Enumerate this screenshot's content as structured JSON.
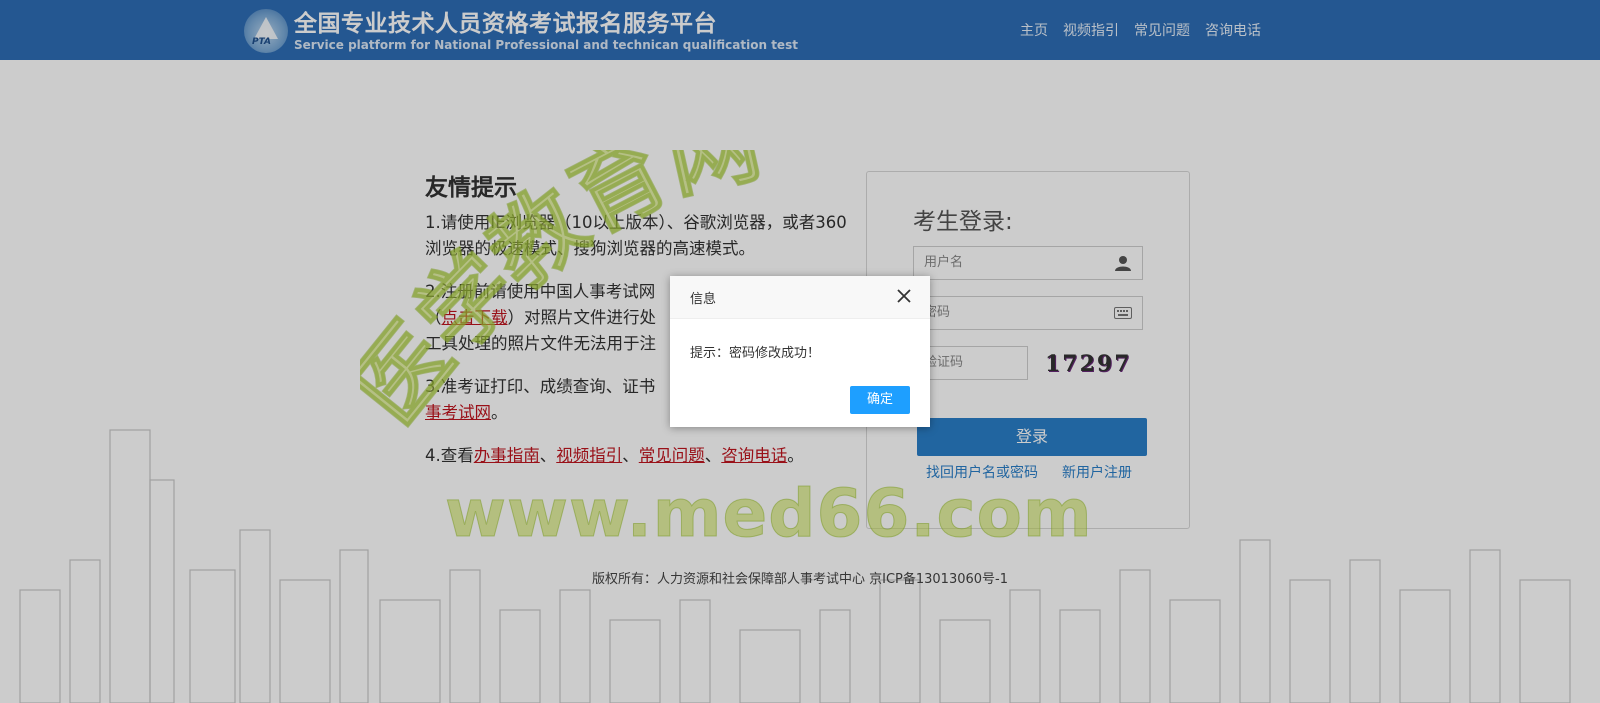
{
  "header": {
    "logo_text": "PTA",
    "title": "全国专业技术人员资格考试报名服务平台",
    "subtitle": "Service platform for National Professional and technican qualification test",
    "nav": [
      "主页",
      "视频指引",
      "常见问题",
      "咨询电话"
    ]
  },
  "tips": {
    "title": "友情提示",
    "item1": "1.请使用IE浏览器（10以上版本）、谷歌浏览器，或者360浏览器的极速模式、搜狗浏览器的高速模式。",
    "item2": {
      "a": "2.注册前请使用中国人事考试网",
      "b": "（",
      "link": "点击下载",
      "c": "）对照片文件进行处",
      "d": "工具处理的照片文件无法用于注"
    },
    "item3": {
      "a": "3.准考证打印、成绩查询、证书",
      "link": "事考试网",
      "end": "。"
    },
    "item4": {
      "prefix": "4.查看",
      "links": [
        "办事指南",
        "视频指引",
        "常见问题",
        "咨询电话"
      ],
      "sep": "、",
      "end": "。"
    }
  },
  "login": {
    "title": "考生登录:",
    "username_placeholder": "用户名",
    "password_placeholder": "密码",
    "captcha_placeholder": "验证码",
    "captcha": "17297",
    "button": "登录",
    "forgot": "找回用户名或密码",
    "register": "新用户注册"
  },
  "footer": "版权所有：人力资源和社会保障部人事考试中心 京ICP备13013060号-1",
  "watermark": {
    "arc": "医学教育网",
    "url": "www.med66.com"
  },
  "dialog": {
    "title": "信息",
    "message": "提示：密码修改成功！",
    "ok": "确定"
  },
  "colors": {
    "header_bg": "#2d6db6",
    "link_red": "#c0141e",
    "login_button": "#2a7fc9",
    "dialog_ok": "#1e9fff"
  }
}
